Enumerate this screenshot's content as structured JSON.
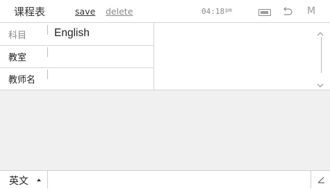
{
  "header": {
    "app_title": "课程表",
    "save_label": "save",
    "delete_label": "delete",
    "time": "04:18",
    "ampm": "pm",
    "menu_label": "M"
  },
  "form": {
    "rows": [
      {
        "label": "科目",
        "value": "English"
      },
      {
        "label": "教室",
        "value": ""
      },
      {
        "label": "教师名",
        "value": ""
      }
    ]
  },
  "footer": {
    "ime_label": "英文"
  },
  "icons": {
    "battery": "battery-icon",
    "back": "back-icon",
    "scroll_up": "chevron-up-icon",
    "scroll_down": "chevron-down-icon",
    "expand": "corner-expand-icon"
  }
}
